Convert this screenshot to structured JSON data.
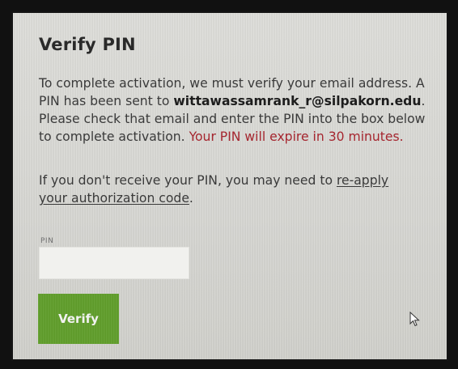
{
  "title": "Verify PIN",
  "message": {
    "intro": "To complete activation, we must verify your email address. A PIN has been sent to ",
    "email": "wittawassamrank_r@silpakorn.edu",
    "middle": ". Please check that email and enter the PIN into the box below to complete activation. ",
    "warning": "Your PIN will expire in 30 minutes."
  },
  "reapply": {
    "prefix": "If you don't receive your PIN, you may need to ",
    "link": "re-apply your authorization code",
    "suffix": "."
  },
  "pin": {
    "label": "PIN",
    "value": "",
    "placeholder": ""
  },
  "verify_button": "Verify",
  "colors": {
    "warning": "#a5262f",
    "button": "#5f9d2a"
  },
  "icons": {
    "cursor": "mouse-pointer-icon"
  }
}
